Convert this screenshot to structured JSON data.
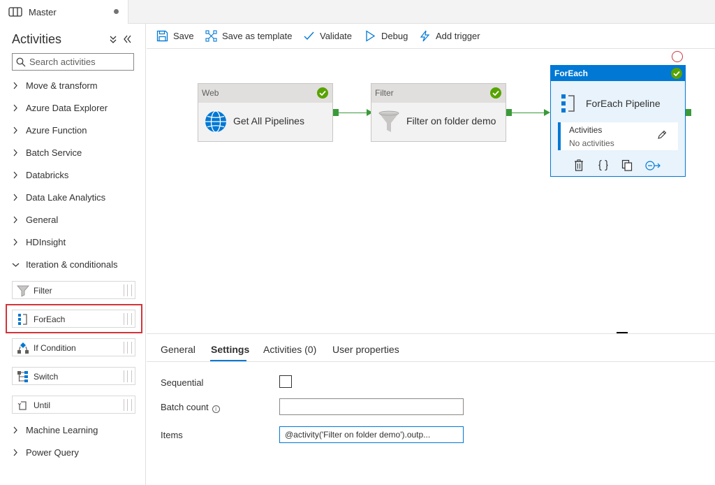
{
  "tab": {
    "title": "Master"
  },
  "sidebar": {
    "title": "Activities",
    "search_placeholder": "Search activities",
    "categories_top": [
      "Move & transform",
      "Azure Data Explorer",
      "Azure Function",
      "Batch Service",
      "Databricks",
      "Data Lake Analytics",
      "General",
      "HDInsight"
    ],
    "expanded_category": "Iteration & conditionals",
    "activities": [
      "Filter",
      "ForEach",
      "If Condition",
      "Switch",
      "Until"
    ],
    "categories_bottom": [
      "Machine Learning",
      "Power Query"
    ]
  },
  "toolbar": {
    "save": "Save",
    "save_template": "Save as template",
    "validate": "Validate",
    "debug": "Debug",
    "add_trigger": "Add trigger"
  },
  "canvas": {
    "web": {
      "type": "Web",
      "title": "Get All Pipelines"
    },
    "filter": {
      "type": "Filter",
      "title": "Filter on folder demo"
    },
    "foreach": {
      "type": "ForEach",
      "title": "ForEach Pipeline",
      "activities_label": "Activities",
      "activities_value": "No activities"
    }
  },
  "properties": {
    "tabs": [
      "General",
      "Settings",
      "Activities (0)",
      "User properties"
    ],
    "active_tab": "Settings",
    "sequential_label": "Sequential",
    "batch_count_label": "Batch count",
    "batch_count_value": "",
    "items_label": "Items",
    "items_value": "@activity('Filter on folder demo').outp..."
  },
  "colors": {
    "accent": "#0078d4",
    "success": "#57a300",
    "connector": "#3a9a3a",
    "highlight": "#d13438"
  },
  "icons": {
    "tab": "pipeline-icon",
    "web": "globe-icon",
    "filter": "funnel-icon",
    "foreach": "foreach-icon",
    "status": "check-circle-icon"
  }
}
